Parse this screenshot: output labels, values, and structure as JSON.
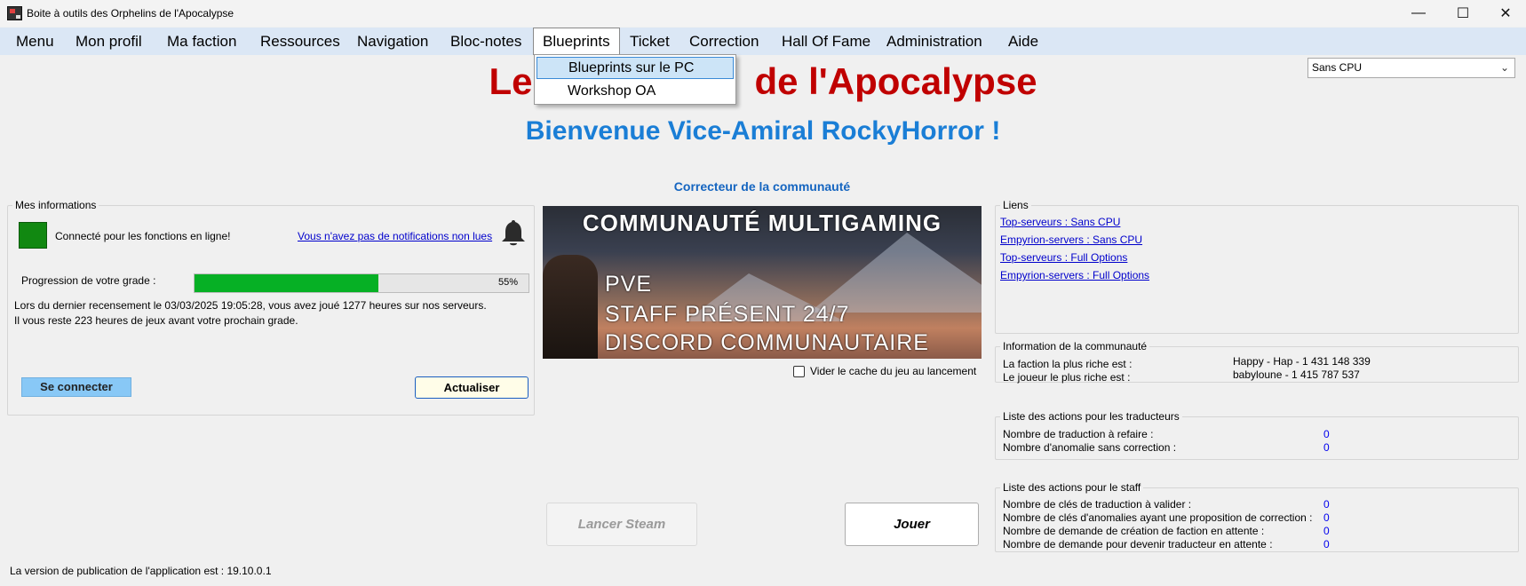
{
  "window": {
    "title": "Boite à outils des Orphelins de l'Apocalypse",
    "controls": {
      "minimize": "—",
      "maximize": "☐",
      "close": "✕"
    }
  },
  "menubar": {
    "items": [
      "Menu",
      "Mon profil",
      "Ma faction",
      "Ressources",
      "Navigation",
      "Bloc-notes",
      "Blueprints",
      "Ticket",
      "Correction",
      "Hall Of Fame",
      "Administration",
      "Aide"
    ],
    "open_menu": "Blueprints",
    "dropdown": [
      "Blueprints sur le PC",
      "Workshop OA"
    ]
  },
  "server_select": {
    "value": "Sans CPU"
  },
  "header": {
    "title_left": "Le",
    "title_right": "de l'Apocalypse",
    "welcome": "Bienvenue Vice-Amiral RockyHorror !"
  },
  "corrector_label": "Correcteur de la communauté",
  "mes_informations": {
    "legend": "Mes informations",
    "status_text": "Connecté pour les fonctions en ligne!",
    "status_color": "#118811",
    "notifications_link": "Vous n'avez pas de notifications non lues",
    "progress_label": "Progression de votre grade :",
    "progress_value": 55,
    "progress_text": "55%",
    "census_line": "Lors du dernier recensement le 03/03/2025 19:05:28, vous avez joué 1277 heures sur nos serveurs.",
    "remaining_line": "Il vous reste 223 heures de jeux avant votre prochain grade.",
    "connect_button": "Se connecter",
    "refresh_button": "Actualiser"
  },
  "banner": {
    "headline": "COMMUNAUTÉ MULTIGAMING",
    "lines": [
      "PVE",
      "STAFF PRÉSENT 24/7",
      "DISCORD COMMUNAUTAIRE"
    ]
  },
  "cache_checkbox": {
    "label": "Vider le cache du jeu au lancement",
    "checked": false
  },
  "liens": {
    "legend": "Liens",
    "links": [
      "Top-serveurs : Sans CPU",
      "Empyrion-servers : Sans CPU",
      "Top-serveurs : Full Options",
      "Empyrion-servers : Full Options"
    ]
  },
  "communaute": {
    "legend": "Information de la communauté",
    "rows": [
      {
        "label": "La faction la plus riche est :",
        "value": "Happy - Hap - 1 431 148 339"
      },
      {
        "label": "Le joueur le plus riche est :",
        "value": "babyloune - 1 415 787 537"
      }
    ]
  },
  "traducteurs": {
    "legend": "Liste des actions pour les traducteurs",
    "rows": [
      {
        "label": "Nombre de traduction à refaire :",
        "value": "0"
      },
      {
        "label": "Nombre d'anomalie sans correction :",
        "value": "0"
      }
    ]
  },
  "staff": {
    "legend": "Liste des actions pour le staff",
    "rows": [
      {
        "label": "Nombre de clés de traduction à valider :",
        "value": "0"
      },
      {
        "label": "Nombre de clés d'anomalies ayant une proposition de correction :",
        "value": "0"
      },
      {
        "label": "Nombre de demande de création de faction en attente :",
        "value": "0"
      },
      {
        "label": "Nombre de demande pour devenir traducteur en attente :",
        "value": "0"
      }
    ]
  },
  "buttons": {
    "steam": "Lancer Steam",
    "play": "Jouer"
  },
  "version": "La version de publication de l'application est : 19.10.0.1"
}
